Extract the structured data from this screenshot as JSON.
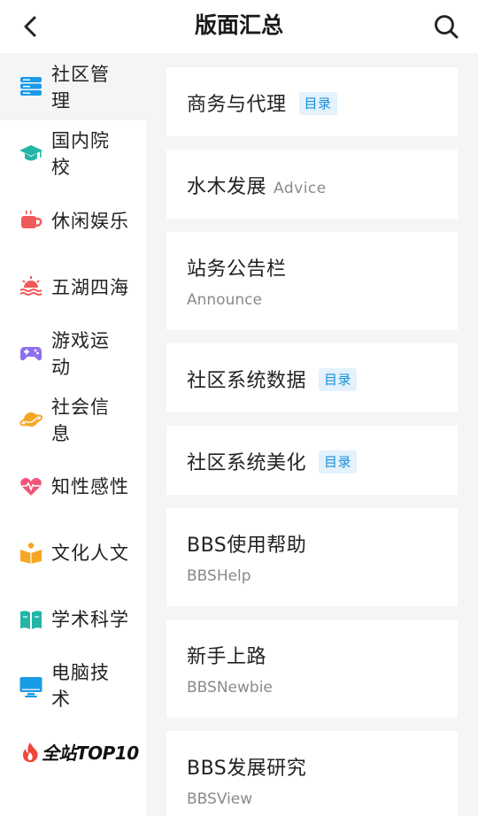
{
  "header": {
    "title": "版面汇总",
    "back_icon": "back-chevron-icon",
    "search_icon": "search-icon"
  },
  "sidebar": {
    "items": [
      {
        "label": "社区管理",
        "icon": "server-stack-icon",
        "color": "#1a9be6",
        "active": true
      },
      {
        "label": "国内院校",
        "icon": "graduation-cap-icon",
        "color": "#23b6a6"
      },
      {
        "label": "休闲娱乐",
        "icon": "coffee-cup-icon",
        "color": "#f05a5a"
      },
      {
        "label": "五湖四海",
        "icon": "sunset-waves-icon",
        "color": "#f05a5a"
      },
      {
        "label": "游戏运动",
        "icon": "gamepad-icon",
        "color": "#8e6ff0"
      },
      {
        "label": "社会信息",
        "icon": "planet-icon",
        "color": "#f5a623"
      },
      {
        "label": "知性感性",
        "icon": "heartbeat-icon",
        "color": "#f0567a"
      },
      {
        "label": "文化人文",
        "icon": "open-book-person-icon",
        "color": "#f5a623"
      },
      {
        "label": "学术科学",
        "icon": "book-icon",
        "color": "#23b6a6"
      },
      {
        "label": "电脑技术",
        "icon": "monitor-icon",
        "color": "#1a9be6"
      }
    ],
    "top10": {
      "label": "全站TOP10",
      "icon": "flame-icon",
      "color": "#f0453a"
    }
  },
  "boards": [
    {
      "title": "商务与代理",
      "tag": "目录"
    },
    {
      "title": "水木发展",
      "inline_sub": "Advice"
    },
    {
      "title": "站务公告栏",
      "sub": "Announce"
    },
    {
      "title": "社区系统数据",
      "tag": "目录"
    },
    {
      "title": "社区系统美化",
      "tag": "目录"
    },
    {
      "title": "BBS使用帮助",
      "sub": "BBSHelp"
    },
    {
      "title": "新手上路",
      "sub": "BBSNewbie"
    },
    {
      "title": "BBS发展研究",
      "sub": "BBSView"
    }
  ]
}
